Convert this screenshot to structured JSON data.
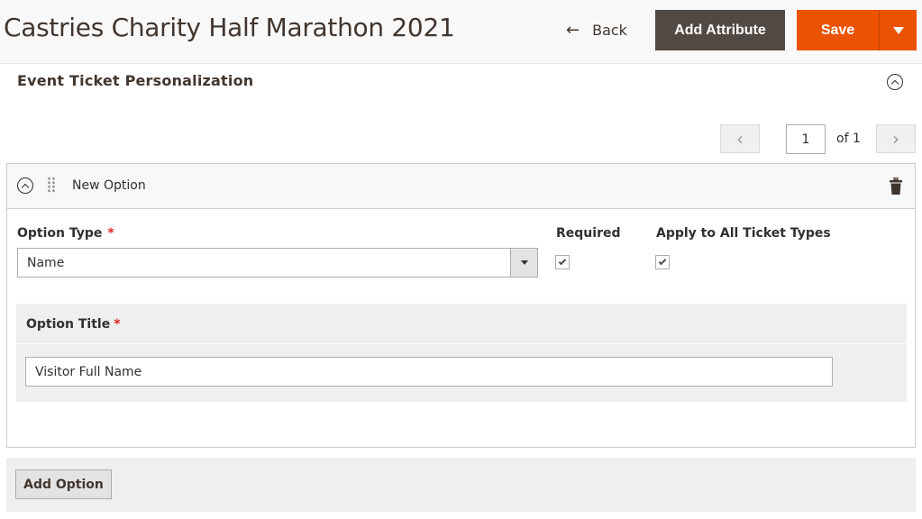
{
  "header": {
    "title": "Castries Charity Half Marathon 2021",
    "back_label": "Back",
    "add_attribute_label": "Add Attribute",
    "save_label": "Save"
  },
  "section": {
    "title": "Event Ticket Personalization"
  },
  "pager": {
    "current_page": "1",
    "total_label": "of 1",
    "prev_icon": "‹",
    "next_icon": "›"
  },
  "option": {
    "name": "New Option",
    "option_type_label": "Option Type",
    "required_star": "*",
    "option_type_value": "Name",
    "required_label": "Required",
    "required_checked": true,
    "apply_all_label": "Apply to All Ticket Types",
    "apply_all_checked": true,
    "option_title_label": "Option Title",
    "option_title_value": "Visitor Full Name"
  },
  "footer": {
    "add_option_label": "Add Option"
  },
  "colors": {
    "primary_orange": "#eb5202",
    "secondary_dark": "#514943",
    "required_red": "#e22626"
  }
}
